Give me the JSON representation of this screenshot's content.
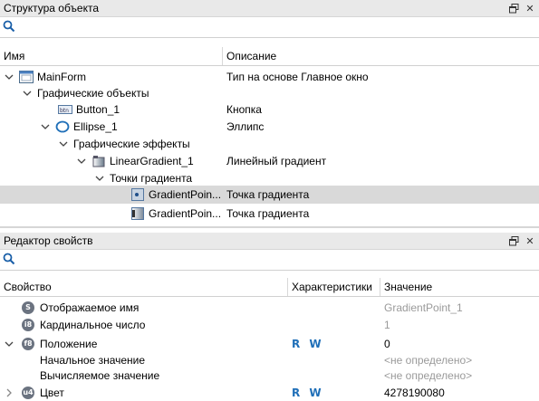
{
  "structure_panel": {
    "title": "Структура объекта",
    "search_placeholder": "",
    "col_name": "Имя",
    "col_desc": "Описание",
    "rows": [
      {
        "name": "MainForm",
        "desc": "Тип на основе Главное окно"
      },
      {
        "name": "Графические объекты",
        "desc": ""
      },
      {
        "name": "Button_1",
        "desc": "Кнопка"
      },
      {
        "name": "Ellipse_1",
        "desc": "Эллипс"
      },
      {
        "name": "Графические эффекты",
        "desc": ""
      },
      {
        "name": "LinearGradient_1",
        "desc": "Линейный градиент"
      },
      {
        "name": "Точки градиента",
        "desc": ""
      },
      {
        "name": "GradientPoin...",
        "desc": "Точка градиента"
      },
      {
        "name": "GradientPoin...",
        "desc": "Точка градиента"
      }
    ]
  },
  "props_panel": {
    "title": "Редактор свойств",
    "search_placeholder": "",
    "col_prop": "Свойство",
    "col_char": "Характеристики",
    "col_value": "Значение",
    "rows": [
      {
        "badge": "S",
        "name": "Отображаемое имя",
        "char": "",
        "value": "GradientPoint_1"
      },
      {
        "badge": "i8",
        "name": "Кардинальное число",
        "char": "",
        "value": "1"
      },
      {
        "badge": "f8",
        "name": "Положение",
        "char": "R W",
        "value": "0"
      },
      {
        "badge": "",
        "name": "Начальное значение",
        "char": "",
        "value": "<не определено>"
      },
      {
        "badge": "",
        "name": "Вычисляемое значение",
        "char": "",
        "value": "<не определено>"
      },
      {
        "badge": "u4",
        "name": "Цвет",
        "char": "R W",
        "value": "4278190080"
      }
    ]
  },
  "colors": {
    "accent": "#1f6fb8",
    "selection": "#d9d9d9"
  }
}
